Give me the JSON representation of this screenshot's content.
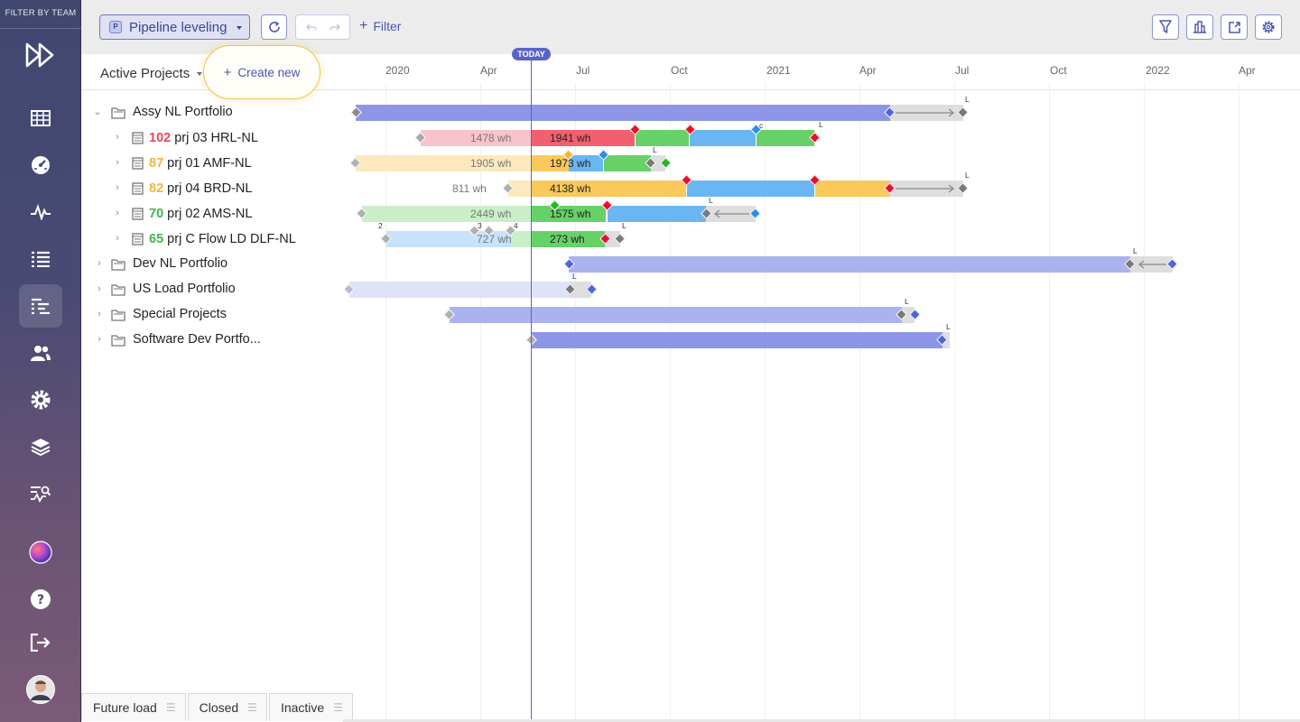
{
  "sidebar": {
    "filter_label": "FILTER BY TEAM",
    "items": [
      {
        "name": "logo-icon"
      },
      {
        "name": "grid-icon"
      },
      {
        "name": "dashboard-icon"
      },
      {
        "name": "pulse-icon"
      },
      {
        "name": "list-icon"
      },
      {
        "name": "pipeline-icon",
        "active": true
      },
      {
        "name": "users-icon"
      },
      {
        "name": "settings-icon"
      },
      {
        "name": "layers-icon"
      },
      {
        "name": "analytics-icon"
      },
      {
        "name": "app-orb-icon"
      },
      {
        "name": "help-icon"
      },
      {
        "name": "logout-icon"
      },
      {
        "name": "user-avatar"
      }
    ]
  },
  "toolbar": {
    "view_badge": "P",
    "view_label": "Pipeline leveling",
    "filter_label": "Filter",
    "right_icons": [
      "funnel-icon",
      "columns-icon",
      "export-icon",
      "gear-icon"
    ]
  },
  "header": {
    "active_projects": "Active Projects",
    "create_new": "Create new",
    "today": "TODAY",
    "timeline": [
      "2020",
      "Apr",
      "Jul",
      "Oct",
      "2021",
      "Apr",
      "Jul",
      "Oct",
      "2022",
      "Apr"
    ]
  },
  "rows": [
    {
      "name": "Assy NL Portfolio",
      "expanded": true,
      "portfolio": true
    },
    {
      "score": "102",
      "name": "prj 03 HRL-NL",
      "score_color": "#e8455b",
      "before": "1478 wh",
      "after": "1941 wh"
    },
    {
      "score": "87",
      "name": "prj 01 AMF-NL",
      "score_color": "#f2b63a",
      "before": "1905 wh",
      "after": "1973 wh"
    },
    {
      "score": "82",
      "name": "prj 04 BRD-NL",
      "score_color": "#f2b63a",
      "before": "811 wh",
      "after": "4138 wh"
    },
    {
      "score": "70",
      "name": "prj 02 AMS-NL",
      "score_color": "#42b54a",
      "before": "2449 wh",
      "after": "1575 wh"
    },
    {
      "score": "65",
      "name": "prj C Flow LD DLF-NL",
      "score_color": "#42b54a",
      "before": "727 wh",
      "after": "273 wh"
    },
    {
      "name": "Dev NL Portfolio",
      "portfolio": true
    },
    {
      "name": "US Load Portfolio",
      "portfolio": true
    },
    {
      "name": "Special Projects",
      "portfolio": true
    },
    {
      "name": "Software Dev Portfo...",
      "portfolio": true
    }
  ],
  "milestone_marks": {
    "L": "L",
    "c": "c",
    "two": "2",
    "three": "3",
    "four": "4"
  },
  "bottom_tabs": [
    "Future load",
    "Closed",
    "Inactive"
  ],
  "colors": {
    "accent": "#5a64c8",
    "red": "#f2606f",
    "green": "#66d167",
    "blue": "#6ab6f2",
    "yellow": "#f9c95b",
    "portfolio": "#8d96e6"
  }
}
